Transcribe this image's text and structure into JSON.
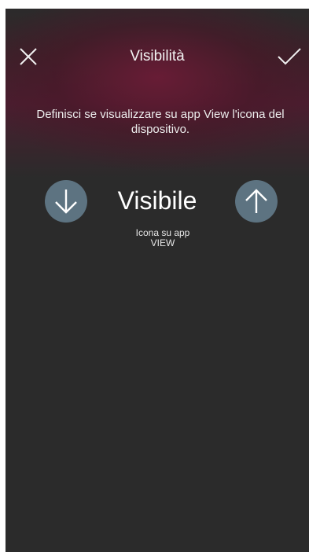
{
  "header": {
    "title": "Visibilità",
    "close_icon": "close-icon",
    "confirm_icon": "checkmark-icon"
  },
  "description": "Definisci se visualizzare su app View l'icona del dispositivo.",
  "selector": {
    "value": "Visibile",
    "sublabel_line1": "Icona su app",
    "sublabel_line2": "VIEW",
    "decrease_icon": "arrow-down-icon",
    "increase_icon": "arrow-up-icon"
  },
  "colors": {
    "background": "#2b2b2b",
    "accent_glow": "#6e1c37",
    "button": "#5d7381",
    "text": "#ffffff"
  }
}
